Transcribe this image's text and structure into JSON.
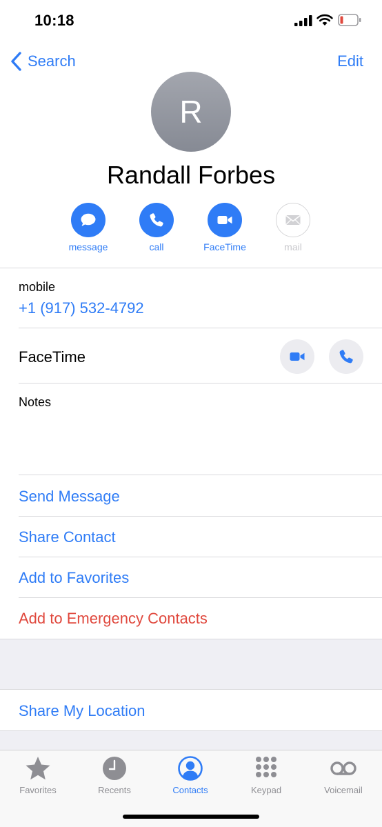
{
  "status": {
    "time": "10:18"
  },
  "nav": {
    "back_label": "Search",
    "edit_label": "Edit"
  },
  "contact": {
    "initial": "R",
    "name": "Randall Forbes"
  },
  "actions": [
    {
      "label": "message",
      "icon": "message-icon"
    },
    {
      "label": "call",
      "icon": "phone-icon"
    },
    {
      "label": "FaceTime",
      "icon": "video-camera-icon"
    },
    {
      "label": "mail",
      "icon": "mail-icon",
      "disabled": true
    }
  ],
  "phone": {
    "label": "mobile",
    "number": "+1 (917) 532-4792"
  },
  "facetime": {
    "label": "FaceTime"
  },
  "notes": {
    "label": "Notes"
  },
  "links": {
    "send_message": "Send Message",
    "share_contact": "Share Contact",
    "add_favorites": "Add to Favorites",
    "add_emergency": "Add to Emergency Contacts",
    "share_location": "Share My Location"
  },
  "tabs": [
    {
      "label": "Favorites",
      "icon": "star-icon"
    },
    {
      "label": "Recents",
      "icon": "clock-icon"
    },
    {
      "label": "Contacts",
      "icon": "person-circle-icon",
      "active": true
    },
    {
      "label": "Keypad",
      "icon": "keypad-icon"
    },
    {
      "label": "Voicemail",
      "icon": "voicemail-icon"
    }
  ],
  "colors": {
    "accent": "#2f7cf6",
    "destructive": "#e0483d",
    "inactive": "#8e8e93"
  }
}
